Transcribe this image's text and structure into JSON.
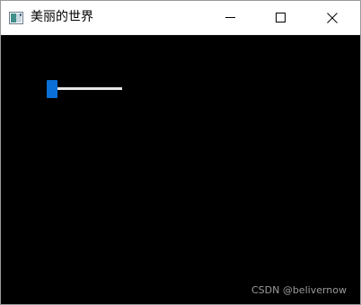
{
  "window": {
    "title": "美丽的世界"
  },
  "titlebar": {
    "icon": "app-window-icon",
    "buttons": [
      {
        "name": "minimize",
        "icon": "minimize-icon"
      },
      {
        "name": "maximize",
        "icon": "maximize-icon"
      },
      {
        "name": "close",
        "icon": "close-icon"
      }
    ]
  },
  "canvas": {
    "background": "#000000",
    "slider": {
      "thumb_color": "#0a6fd6",
      "track_color": "#e6e6e6",
      "value": 0.0
    }
  },
  "watermark": {
    "text": "CSDN @belivernow"
  }
}
